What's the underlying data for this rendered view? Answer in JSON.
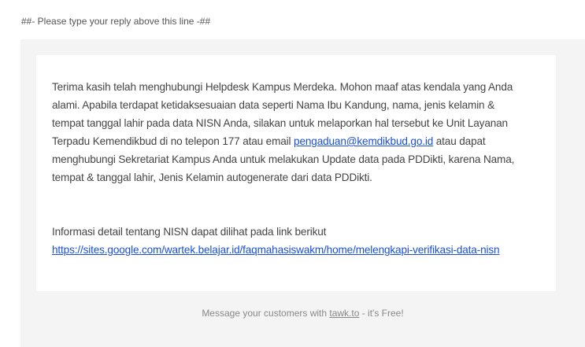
{
  "delimiter": "##- Please type your reply above this line -##",
  "message": {
    "para1_lines": [
      "Terima kasih telah menghubungi Helpdesk Kampus Merdeka. Mohon maaf atas kendala yang Anda",
      "alami. Apabila terdapat ketidaksesuaian data seperti Nama Ibu Kandung, nama, jenis kelamin &",
      "tempat tanggal lahir pada data NISN Anda, silakan untuk melaporkan hal tersebut ke Unit Layanan"
    ],
    "line4_before": "Terpadu Kemendikbud di no telepon 177 atau email ",
    "email_link": "pengaduan@kemdikbud.go.id",
    "line4_after": " atau dapat",
    "para1_rest": [
      "menghubungi Sekretariat Kampus Anda untuk melakukan Update data pada PDDikti, karena Nama,",
      "tempat & tanggal lahir, Jenis Kelamin autogenerate dari data PDDikti."
    ],
    "para2_text": "Informasi detail tentang NISN dapat dilihat pada link berikut",
    "para2_link": "https://sites.google.com/wartek.belajar.id/faqmahasiswakm/home/melengkapi-verifikasi-data-nisn"
  },
  "footer": {
    "before": "Message your customers with ",
    "link": "tawk.to",
    "after": " - it's Free!"
  }
}
